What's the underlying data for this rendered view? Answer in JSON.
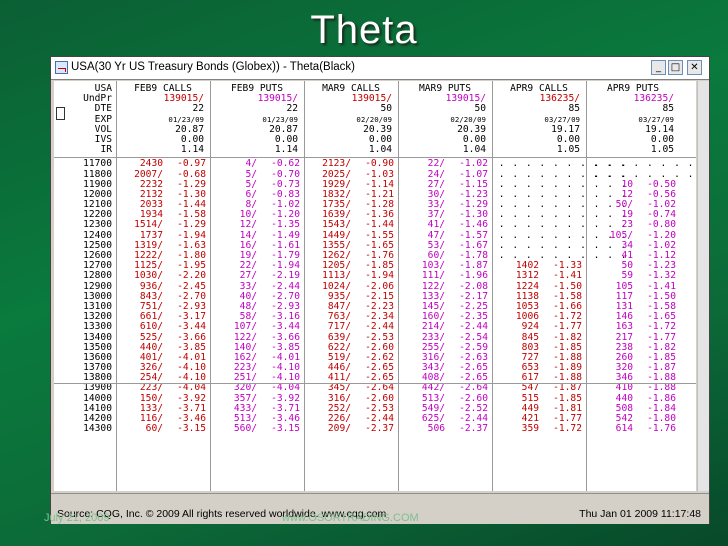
{
  "slide": {
    "title": "Theta",
    "date": "July 21, 2009",
    "url": "www.OSORTRADING.COM"
  },
  "window": {
    "title": "USA(30 Yr US Treasury Bonds (Globex)) - Theta(Black)",
    "min_glyph": "_",
    "max_glyph": "□",
    "close_glyph": "✕"
  },
  "header_labels": [
    "USA",
    "UndPr",
    "DTE",
    "EXP",
    "VOL",
    "IVS",
    "IR"
  ],
  "columns": [
    {
      "name": "FEB9 CALLS",
      "undpr": "139015/",
      "dte": "22",
      "exp": "01/23/09",
      "vol": "20.87",
      "ivs": "0.00",
      "ir": "1.14"
    },
    {
      "name": "FEB9 PUTS",
      "undpr": "139015/",
      "dte": "22",
      "exp": "01/23/09",
      "vol": "20.87",
      "ivs": "0.00",
      "ir": "1.14"
    },
    {
      "name": "MAR9 CALLS",
      "undpr": "139015/",
      "dte": "50",
      "exp": "02/20/09",
      "vol": "20.39",
      "ivs": "0.00",
      "ir": "1.04"
    },
    {
      "name": "MAR9 PUTS",
      "undpr": "139015/",
      "dte": "50",
      "exp": "02/20/09",
      "vol": "20.39",
      "ivs": "0.00",
      "ir": "1.04"
    },
    {
      "name": "APR9 CALLS",
      "undpr": "136235/",
      "dte": "85",
      "exp": "03/27/09",
      "vol": "19.17",
      "ivs": "0.00",
      "ir": "1.05"
    },
    {
      "name": "APR9 PUTS",
      "undpr": "136235/",
      "dte": "85",
      "exp": "03/27/09",
      "vol": "19.14",
      "ivs": "0.00",
      "ir": "1.05"
    }
  ],
  "rows": [
    {
      "k": "11700",
      "c": [
        [
          "2430",
          "-0.97"
        ],
        [
          "4/",
          "-0.62"
        ],
        [
          "2123/",
          "-0.90"
        ],
        [
          "22/",
          "-1.02"
        ],
        [
          "",
          ""
        ],
        [
          "",
          ""
        ]
      ]
    },
    {
      "k": "11800",
      "c": [
        [
          "2007/",
          "-0.68"
        ],
        [
          "5/",
          "-0.70"
        ],
        [
          "2025/",
          "-1.03"
        ],
        [
          "24/",
          "-1.07"
        ],
        [
          "",
          ""
        ],
        [
          "",
          ""
        ]
      ]
    },
    {
      "k": "11900",
      "c": [
        [
          "2232",
          "-1.29"
        ],
        [
          "5/",
          "-0.73"
        ],
        [
          "1929/",
          "-1.14"
        ],
        [
          "27/",
          "-1.15"
        ],
        [
          "",
          ""
        ],
        [
          "10",
          "-0.50"
        ]
      ]
    },
    {
      "k": "12000",
      "c": [
        [
          "2132",
          "-1.30"
        ],
        [
          "6/",
          "-0.83"
        ],
        [
          "1832/",
          "-1.21"
        ],
        [
          "30/",
          "-1.23"
        ],
        [
          "",
          ""
        ],
        [
          "12",
          "-0.56"
        ]
      ]
    },
    {
      "k": "12100",
      "c": [
        [
          "2033",
          "-1.44"
        ],
        [
          "8/",
          "-1.02"
        ],
        [
          "1735/",
          "-1.28"
        ],
        [
          "33/",
          "-1.29"
        ],
        [
          "",
          ""
        ],
        [
          "50/",
          "-1.02"
        ]
      ]
    },
    {
      "k": "12200",
      "c": [
        [
          "1934",
          "-1.58"
        ],
        [
          "10/",
          "-1.20"
        ],
        [
          "1639/",
          "-1.36"
        ],
        [
          "37/",
          "-1.30"
        ],
        [
          "",
          ""
        ],
        [
          "19",
          "-0.74"
        ]
      ]
    },
    {
      "k": "12300",
      "c": [
        [
          "1514/",
          "-1.29"
        ],
        [
          "12/",
          "-1.35"
        ],
        [
          "1543/",
          "-1.44"
        ],
        [
          "41/",
          "-1.46"
        ],
        [
          "",
          ""
        ],
        [
          "23",
          "-0.80"
        ]
      ]
    },
    {
      "k": "12400",
      "c": [
        [
          "1737",
          "-1.94"
        ],
        [
          "14/",
          "-1.49"
        ],
        [
          "1449/",
          "-1.55"
        ],
        [
          "47/",
          "-1.57"
        ],
        [
          "",
          ""
        ],
        [
          "105/",
          "-1.20"
        ]
      ]
    },
    {
      "k": "12500",
      "c": [
        [
          "1319/",
          "-1.63"
        ],
        [
          "16/",
          "-1.61"
        ],
        [
          "1355/",
          "-1.65"
        ],
        [
          "53/",
          "-1.67"
        ],
        [
          "",
          ""
        ],
        [
          "34",
          "-1.02"
        ]
      ]
    },
    {
      "k": "12600",
      "c": [
        [
          "1222/",
          "-1.80"
        ],
        [
          "19/",
          "-1.79"
        ],
        [
          "1262/",
          "-1.76"
        ],
        [
          "60/",
          "-1.78"
        ],
        [
          "",
          ""
        ],
        [
          "41",
          "-1.12"
        ]
      ]
    },
    {
      "k": "12700",
      "c": [
        [
          "1125/",
          "-1.95"
        ],
        [
          "22/",
          "-1.94"
        ],
        [
          "1205/",
          "-1.85"
        ],
        [
          "103/",
          "-1.87"
        ],
        [
          "1402",
          "-1.33"
        ],
        [
          "50",
          "-1.23"
        ]
      ]
    },
    {
      "k": "12800",
      "c": [
        [
          "1030/",
          "-2.20"
        ],
        [
          "27/",
          "-2.19"
        ],
        [
          "1113/",
          "-1.94"
        ],
        [
          "111/",
          "-1.96"
        ],
        [
          "1312",
          "-1.41"
        ],
        [
          "59",
          "-1.32"
        ]
      ]
    },
    {
      "k": "12900",
      "c": [
        [
          "936/",
          "-2.45"
        ],
        [
          "33/",
          "-2.44"
        ],
        [
          "1024/",
          "-2.06"
        ],
        [
          "122/",
          "-2.08"
        ],
        [
          "1224",
          "-1.50"
        ],
        [
          "105",
          "-1.41"
        ]
      ]
    },
    {
      "k": "13000",
      "c": [
        [
          "843/",
          "-2.70"
        ],
        [
          "40/",
          "-2.70"
        ],
        [
          "935/",
          "-2.15"
        ],
        [
          "133/",
          "-2.17"
        ],
        [
          "1138",
          "-1.58"
        ],
        [
          "117",
          "-1.50"
        ]
      ]
    },
    {
      "k": "13100",
      "c": [
        [
          "751/",
          "-2.93"
        ],
        [
          "48/",
          "-2.93"
        ],
        [
          "847/",
          "-2.23"
        ],
        [
          "145/",
          "-2.25"
        ],
        [
          "1053",
          "-1.66"
        ],
        [
          "131",
          "-1.58"
        ]
      ]
    },
    {
      "k": "13200",
      "c": [
        [
          "661/",
          "-3.17"
        ],
        [
          "58/",
          "-3.16"
        ],
        [
          "763/",
          "-2.34"
        ],
        [
          "160/",
          "-2.35"
        ],
        [
          "1006",
          "-1.72"
        ],
        [
          "146",
          "-1.65"
        ]
      ]
    },
    {
      "k": "13300",
      "c": [
        [
          "610/",
          "-3.44"
        ],
        [
          "107/",
          "-3.44"
        ],
        [
          "717/",
          "-2.44"
        ],
        [
          "214/",
          "-2.44"
        ],
        [
          "924",
          "-1.77"
        ],
        [
          "163",
          "-1.72"
        ]
      ]
    },
    {
      "k": "13400",
      "c": [
        [
          "525/",
          "-3.66"
        ],
        [
          "122/",
          "-3.66"
        ],
        [
          "639/",
          "-2.53"
        ],
        [
          "233/",
          "-2.54"
        ],
        [
          "845",
          "-1.82"
        ],
        [
          "217",
          "-1.77"
        ]
      ]
    },
    {
      "k": "13500",
      "c": [
        [
          "440/",
          "-3.85"
        ],
        [
          "140/",
          "-3.85"
        ],
        [
          "622/",
          "-2.60"
        ],
        [
          "255/",
          "-2.59"
        ],
        [
          "803",
          "-1.85"
        ],
        [
          "238",
          "-1.82"
        ]
      ]
    },
    {
      "k": "13600",
      "c": [
        [
          "401/",
          "-4.01"
        ],
        [
          "162/",
          "-4.01"
        ],
        [
          "519/",
          "-2.62"
        ],
        [
          "316/",
          "-2.63"
        ],
        [
          "727",
          "-1.88"
        ],
        [
          "260",
          "-1.85"
        ]
      ]
    },
    {
      "k": "13700",
      "c": [
        [
          "326/",
          "-4.10"
        ],
        [
          "223/",
          "-4.10"
        ],
        [
          "446/",
          "-2.65"
        ],
        [
          "343/",
          "-2.65"
        ],
        [
          "653",
          "-1.89"
        ],
        [
          "320",
          "-1.87"
        ]
      ]
    },
    {
      "k": "13800",
      "c": [
        [
          "254/",
          "-4.10"
        ],
        [
          "251/",
          "-4.10"
        ],
        [
          "411/",
          "-2.65"
        ],
        [
          "408/",
          "-2.65"
        ],
        [
          "617",
          "-1.88"
        ],
        [
          "346",
          "-1.88"
        ]
      ]
    },
    {
      "k": "13900",
      "c": [
        [
          "223/",
          "-4.04"
        ],
        [
          "320/",
          "-4.04"
        ],
        [
          "345/",
          "-2.64"
        ],
        [
          "442/",
          "-2.64"
        ],
        [
          "547",
          "-1.87"
        ],
        [
          "410",
          "-1.88"
        ]
      ]
    },
    {
      "k": "14000",
      "c": [
        [
          "150/",
          "-3.92"
        ],
        [
          "357/",
          "-3.92"
        ],
        [
          "316/",
          "-2.60"
        ],
        [
          "513/",
          "-2.60"
        ],
        [
          "515",
          "-1.85"
        ],
        [
          "440",
          "-1.86"
        ]
      ]
    },
    {
      "k": "14100",
      "c": [
        [
          "133/",
          "-3.71"
        ],
        [
          "433/",
          "-3.71"
        ],
        [
          "252/",
          "-2.53"
        ],
        [
          "549/",
          "-2.52"
        ],
        [
          "449",
          "-1.81"
        ],
        [
          "508",
          "-1.84"
        ]
      ]
    },
    {
      "k": "14200",
      "c": [
        [
          "116/",
          "-3.46"
        ],
        [
          "513/",
          "-3.46"
        ],
        [
          "226/",
          "-2.44"
        ],
        [
          "625/",
          "-2.44"
        ],
        [
          "421",
          "-1.77"
        ],
        [
          "542",
          "-1.80"
        ]
      ]
    },
    {
      "k": "14300",
      "c": [
        [
          "60/",
          "-3.15"
        ],
        [
          "560/",
          "-3.15"
        ],
        [
          "209/",
          "-2.37"
        ],
        [
          "506",
          "-2.37"
        ],
        [
          "359",
          "-1.72"
        ],
        [
          "614",
          "-1.76"
        ]
      ]
    }
  ],
  "status": {
    "source": "Source: CQG, Inc. © 2009 All rights reserved worldwide. www.cqg.com",
    "timestamp": "Thu Jan 01 2009 11:17:48"
  },
  "colors": {
    "background": "#0a7a3d",
    "calls": "#c00000",
    "puts": "#c000c0"
  }
}
